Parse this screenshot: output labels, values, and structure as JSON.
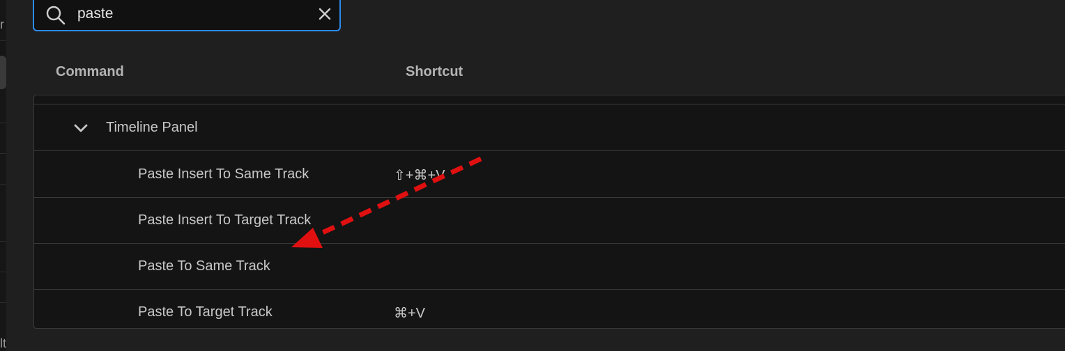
{
  "search": {
    "value": "paste",
    "icon": "search-icon",
    "clear_icon": "close-icon",
    "focus_color": "#2d8ceb"
  },
  "columns": {
    "command": "Command",
    "shortcut": "Shortcut"
  },
  "group": {
    "label": "Timeline Panel",
    "icon": "chevron-down-icon",
    "expanded": true
  },
  "commands": [
    {
      "label": "Paste Insert To Same Track",
      "shortcut": "⇧+⌘+V"
    },
    {
      "label": "Paste Insert To Target Track",
      "shortcut": ""
    },
    {
      "label": "Paste To Same Track",
      "shortcut": ""
    },
    {
      "label": "Paste To Target Track",
      "shortcut": "⌘+V"
    }
  ],
  "left_strip_chars": [
    "r",
    "lt"
  ],
  "annotation": {
    "type": "dashed-arrow",
    "color": "#e01010",
    "points_to": "Paste To Same Track"
  }
}
